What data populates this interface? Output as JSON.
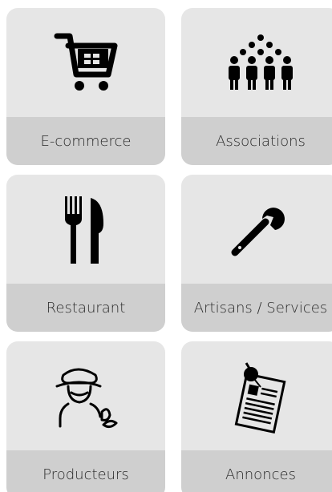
{
  "tiles": [
    {
      "label": "E-commerce",
      "icon": "shopping-cart-icon"
    },
    {
      "label": "Associations",
      "icon": "people-group-icon"
    },
    {
      "label": "Restaurant",
      "icon": "fork-knife-icon"
    },
    {
      "label": "Artisans / Services",
      "icon": "wrench-icon"
    },
    {
      "label": "Producteurs",
      "icon": "farmer-icon"
    },
    {
      "label": "Annonces",
      "icon": "pinned-note-icon"
    }
  ]
}
